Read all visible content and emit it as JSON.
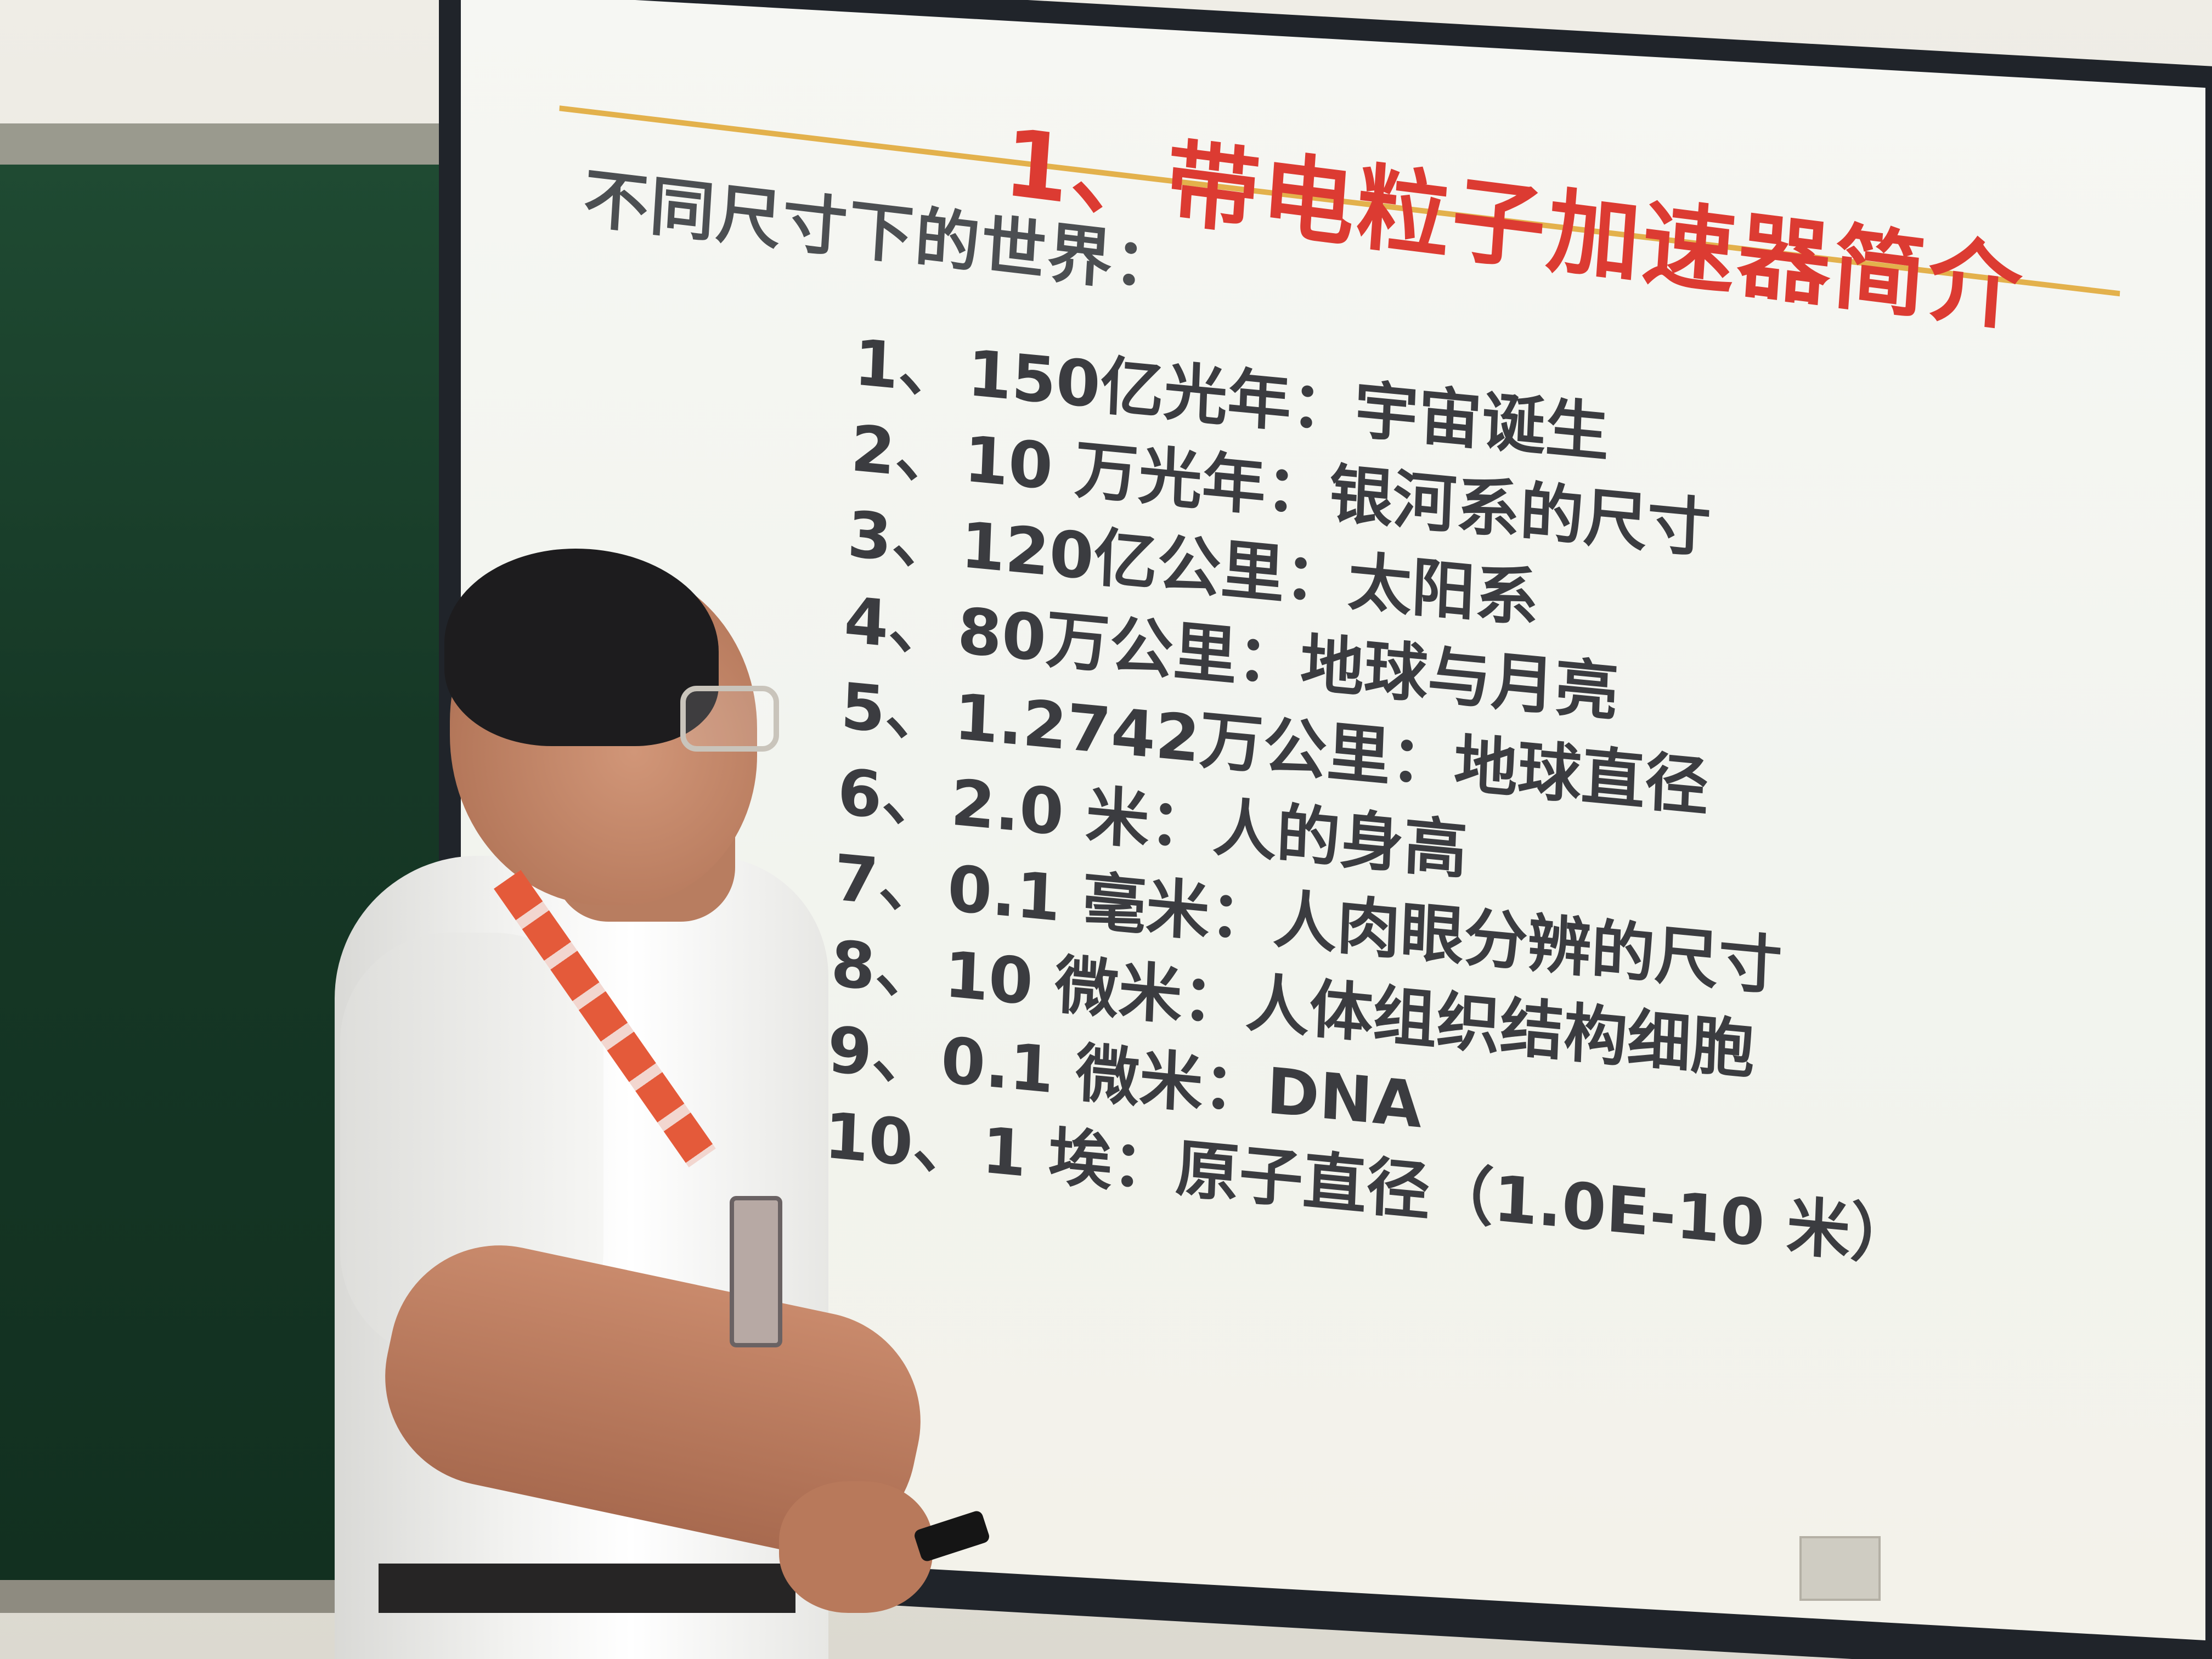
{
  "slide": {
    "title": "1、带电粒子加速器简介",
    "subtitle": "不同尺寸下的世界：",
    "items": [
      {
        "num": "1、",
        "text": "150亿光年：宇宙诞生"
      },
      {
        "num": "2、",
        "text": "10 万光年：银河系的尺寸"
      },
      {
        "num": "3、",
        "text": "120亿公里：太阳系"
      },
      {
        "num": "4、",
        "text": "80万公里：地球与月亮"
      },
      {
        "num": "5、",
        "text": "1.2742万公里：地球直径"
      },
      {
        "num": "6、",
        "text": "2.0 米：人的身高"
      },
      {
        "num": "7、",
        "text": "0.1 毫米：人肉眼分辨的尺寸"
      },
      {
        "num": "8、",
        "text": "10 微米：人体组织结构细胞"
      },
      {
        "num": "9、",
        "text": "0.1 微米：DNA"
      },
      {
        "num": "10、",
        "text": "1 埃：原子直径（1.0E-10 米）"
      }
    ],
    "colors": {
      "title": "#dc3b32",
      "rule": "#e3b14c",
      "text": "#3b3c40"
    }
  },
  "scene": {
    "objects": [
      "projector-screen",
      "chalkboard",
      "presenter",
      "lanyard",
      "badge",
      "remote",
      "wall-outlet"
    ]
  }
}
